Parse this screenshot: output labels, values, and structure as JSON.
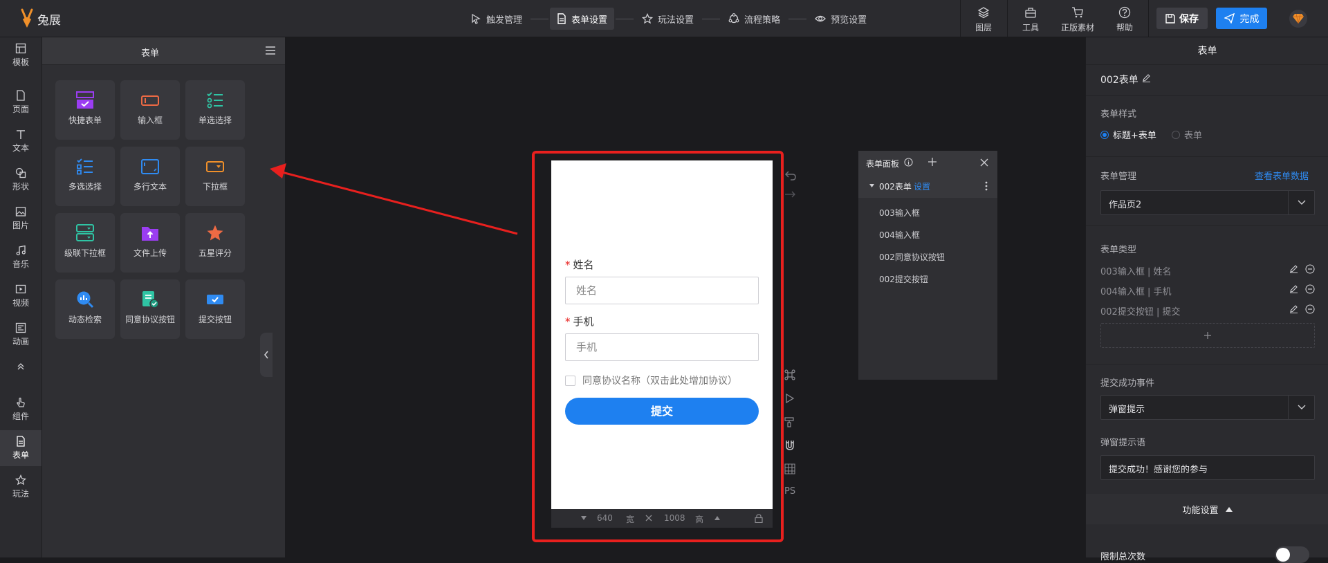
{
  "app": {
    "logo_text": "兔展"
  },
  "steps": [
    {
      "label": "触发管理",
      "icon": "trigger-icon",
      "active": false
    },
    {
      "label": "表单设置",
      "icon": "document-icon",
      "active": true
    },
    {
      "label": "玩法设置",
      "icon": "star-icon",
      "active": false
    },
    {
      "label": "流程策略",
      "icon": "process-icon",
      "active": false
    },
    {
      "label": "预览设置",
      "icon": "eye-icon",
      "active": false
    }
  ],
  "tools": {
    "layers": "图层",
    "tools": "工具",
    "assets": "正版素材",
    "help": "帮助"
  },
  "actions": {
    "save": "保存",
    "done": "完成"
  },
  "leftnav": {
    "template": "模板",
    "page": "页面",
    "text": "文本",
    "shape": "形状",
    "image": "图片",
    "music": "音乐",
    "video": "视频",
    "animation": "动画",
    "component": "组件",
    "form": "表单",
    "play": "玩法"
  },
  "form_panel": {
    "title": "表单",
    "items": [
      "快捷表单",
      "输入框",
      "单选选择",
      "多选选择",
      "多行文本",
      "下拉框",
      "级联下拉框",
      "文件上传",
      "五星评分",
      "动态检索",
      "同意协议按钮",
      "提交按钮"
    ]
  },
  "phone": {
    "name_label": "姓名",
    "name_placeholder": "姓名",
    "phone_label": "手机",
    "phone_placeholder": "手机",
    "agree_text": "同意协议名称（双击此处增加协议）",
    "submit": "提交",
    "width_value": "640",
    "width_unit": "宽",
    "height_value": "1008",
    "height_unit": "高"
  },
  "side_tools": {
    "ps": "PS"
  },
  "tree_panel": {
    "title": "表单面板",
    "root": "002表单",
    "root_link": "设置",
    "children": [
      "003输入框",
      "004输入框",
      "002同意协议按钮",
      "002提交按钮"
    ]
  },
  "right_panel": {
    "title": "表单",
    "form_name": "002表单",
    "style_label": "表单样式",
    "style_option_1": "标题+表单",
    "style_option_2": "表单",
    "manage_label": "表单管理",
    "view_data_link": "查看表单数据",
    "page_select": "作品页2",
    "type_label": "表单类型",
    "type_items": [
      "003输入框 | 姓名",
      "004输入框 | 手机",
      "002提交按钮 | 提交"
    ],
    "success_event_label": "提交成功事件",
    "success_event_select": "弹窗提示",
    "tip_label": "弹窗提示语",
    "tip_value": "提交成功！感谢您的参与",
    "func_settings": "功能设置",
    "limit_label": "限制总次数"
  },
  "colors": {
    "accent": "#1e80f0",
    "highlight": "#e8201e",
    "panel": "#2b2b2f"
  }
}
